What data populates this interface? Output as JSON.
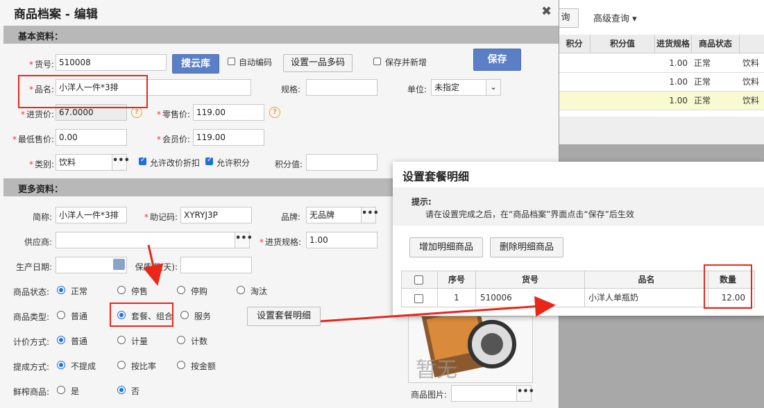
{
  "background": {
    "query_btn": "询",
    "advanced": "高级查询 ▾",
    "headers": [
      "积分",
      "积分值",
      "进货规格",
      "商品状态"
    ],
    "rows": [
      {
        "spec": "1.00",
        "status": "正常",
        "cat": "饮料"
      },
      {
        "spec": "1.00",
        "status": "正常",
        "cat": "饮料"
      },
      {
        "spec": "1.00",
        "status": "正常",
        "cat": "饮料"
      }
    ]
  },
  "dialog": {
    "title": "商品档案 - 编辑",
    "close": "✖",
    "basic_section": "基本资料：",
    "more_section": "更多资料：",
    "goods_no_label": "货号:",
    "goods_no": "510008",
    "search_cloud": "搜云库",
    "auto_code_label": "自动编码",
    "multi_code_btn": "设置一品多码",
    "save_new_label": "保存并新增",
    "save_btn": "保存",
    "name_label": "品名:",
    "name": "小洋人一件*3排",
    "spec_label": "规格:",
    "spec": "",
    "unit_label": "单位:",
    "unit": "未指定",
    "purchase_price_label": "进货价:",
    "purchase_price": "67.0000",
    "retail_price_label": "零售价:",
    "retail_price": "119.00",
    "min_price_label": "最低售价:",
    "min_price": "0.00",
    "member_price_label": "会员价:",
    "member_price": "119.00",
    "category_label": "类别:",
    "category": "饮料",
    "allow_discount_label": "允许改价折扣",
    "allow_points_label": "允许积分",
    "points_value_label": "积分值:",
    "points_value": "",
    "short_name_label": "简称:",
    "short_name": "小洋人一件*3排",
    "mnemonic_label": "助记码:",
    "mnemonic": "XYRYJ3P",
    "brand_label": "品牌:",
    "brand": "无品牌",
    "supplier_label": "供应商:",
    "supplier": "",
    "purchase_spec_label": "进货规格:",
    "purchase_spec": "1.00",
    "prod_date_label": "生产日期:",
    "shelf_life_label": "保质期(天):",
    "status_label": "商品状态:",
    "status_options": [
      "正常",
      "停售",
      "停购",
      "淘汰"
    ],
    "type_label": "商品类型:",
    "type_options": [
      "普通",
      "套餐、组合",
      "服务"
    ],
    "package_detail_btn": "设置套餐明细",
    "pricing_label": "计价方式:",
    "pricing_options": [
      "普通",
      "计量",
      "计数"
    ],
    "commission_label": "提成方式:",
    "commission_options": [
      "不提成",
      "按比率",
      "按金额"
    ],
    "fresh_label": "鲜榨商品:",
    "fresh_options": [
      "是",
      "否"
    ],
    "image_label": "商品图片:",
    "image_watermark": "暂无"
  },
  "popup": {
    "title": "设置套餐明细",
    "tip_title": "提示:",
    "tip_text": "请在设置完成之后，在“商品档案”界面点击“保存”后生效",
    "add_btn": "增加明细商品",
    "del_btn": "删除明细商品",
    "columns": [
      "序号",
      "货号",
      "品名",
      "数量"
    ],
    "rows": [
      {
        "seq": "1",
        "code": "510006",
        "name": "小洋人单瓶奶",
        "qty": "12.00"
      }
    ]
  },
  "colors": {
    "accent": "#1e6fe0",
    "save_btn": "#5a7fc6",
    "annotation": "#e8261a"
  }
}
